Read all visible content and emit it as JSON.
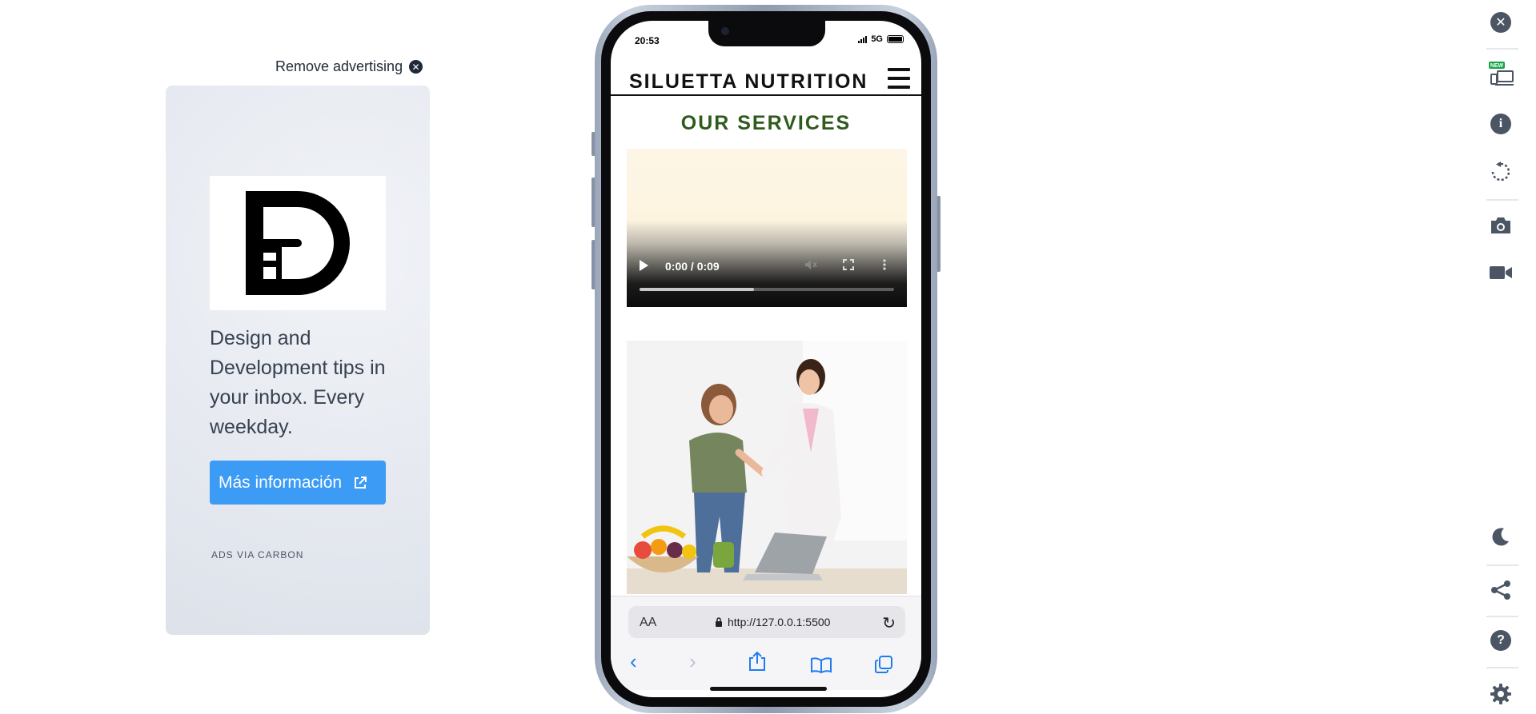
{
  "ad": {
    "remove_label": "Remove advertising",
    "headline": "Design and Development tips in your inbox. Every weekday.",
    "cta_label": "Más información",
    "via_label": "ADS VIA CARBON"
  },
  "phone": {
    "status": {
      "time": "20:53",
      "network": "5G"
    },
    "site": {
      "title": "SILUETTA NUTRITION",
      "section_heading": "OUR SERVICES"
    },
    "video": {
      "time_display": "0:00 / 0:09",
      "progress": 0.45
    },
    "browser": {
      "text_size_label": "AA",
      "url": "http://127.0.0.1:5500"
    }
  },
  "right_toolbar": {
    "new_badge": "NEW",
    "icons": [
      "close-icon",
      "devices-icon",
      "info-icon",
      "rotate-icon",
      "camera-icon",
      "video-record-icon",
      "dark-mode-icon",
      "share-icon",
      "help-icon",
      "settings-icon"
    ]
  },
  "colors": {
    "ad_button": "#3b9bf5",
    "section_heading": "#2e5a1c",
    "safari_accent": "#1e7cf0",
    "badge_green": "#16a34a"
  }
}
